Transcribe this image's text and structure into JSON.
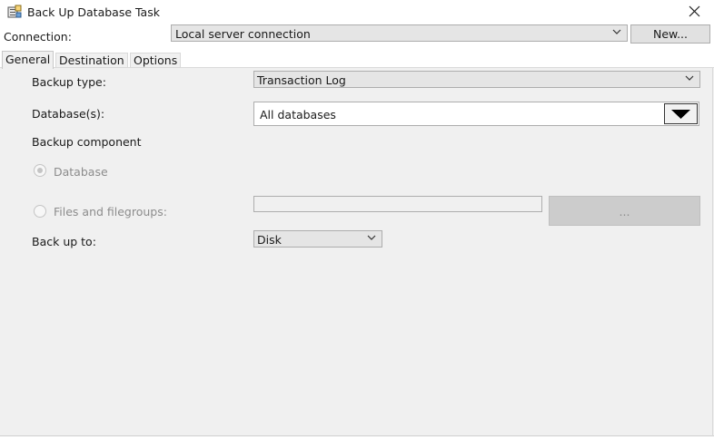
{
  "window": {
    "title": "Back Up Database Task",
    "icon": "database-backup-icon",
    "close_icon": "close-icon"
  },
  "connection": {
    "label": "Connection:",
    "value": "Local server connection",
    "new_button": "New..."
  },
  "tabs": [
    {
      "label": "General",
      "active": true
    },
    {
      "label": "Destination",
      "active": false
    },
    {
      "label": "Options",
      "active": false
    }
  ],
  "general": {
    "backup_type": {
      "label": "Backup type:",
      "value": "Transaction Log"
    },
    "databases": {
      "label": "Database(s):",
      "value": "All databases"
    },
    "backup_component": {
      "heading": "Backup component",
      "database_option": "Database",
      "files_option": "Files and filegroups:",
      "browse_label": "..."
    },
    "back_up_to": {
      "label": "Back up to:",
      "value": "Disk"
    }
  }
}
